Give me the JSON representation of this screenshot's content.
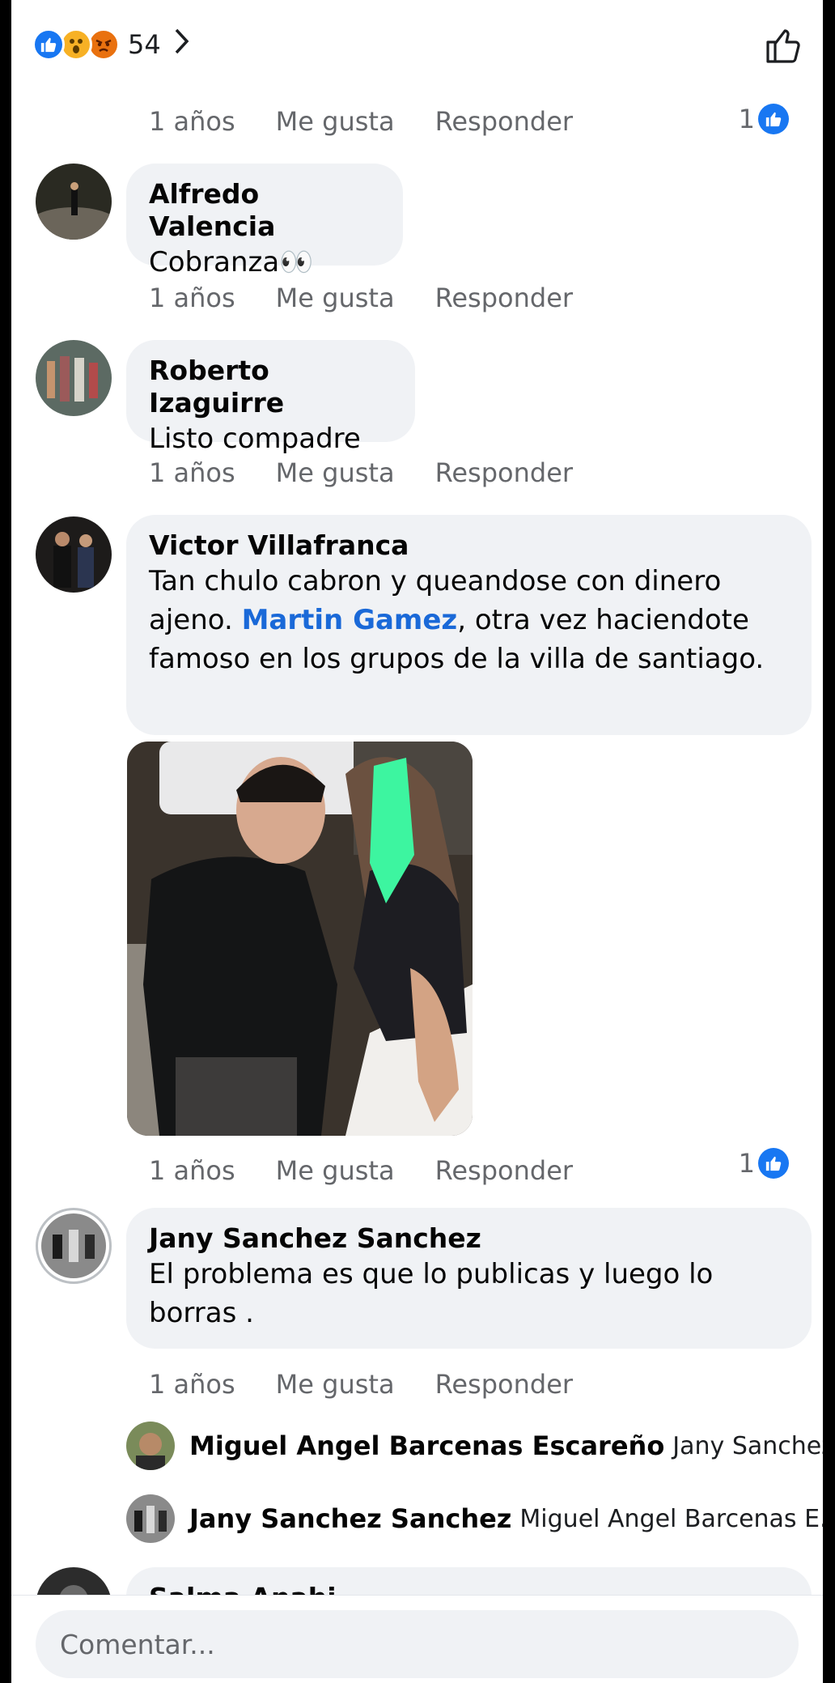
{
  "reactions": {
    "count": "54",
    "types": [
      "like",
      "wow",
      "angry"
    ]
  },
  "actions": {
    "time": "1 años",
    "like": "Me gusta",
    "reply": "Responder"
  },
  "comments": [
    {
      "name": "Alfredo Valencia",
      "text": "Cobranza👀"
    },
    {
      "name": "Roberto Izaguirre",
      "text": "Listo compadre"
    },
    {
      "name": "Victor Villafranca",
      "text_before": "Tan chulo cabron y queandose con dinero ajeno. ",
      "mention": "Martin Gamez",
      "text_after": ", otra vez haciendote famoso en los grupos de la villa de santiago."
    },
    {
      "name": "Jany Sanchez Sanchez",
      "text": "El problema es que lo publicas y luego lo borras ."
    },
    {
      "name": "Salma Anahi"
    }
  ],
  "comment_likes": [
    "1",
    "1"
  ],
  "replies": [
    {
      "name": "Miguel Angel Barcenas Escareño",
      "text": "Jany Sanchez..."
    },
    {
      "name": "Jany Sanchez Sanchez",
      "text": "Miguel Angel Barcenas E..."
    }
  ],
  "composer": {
    "placeholder": "Comentar..."
  },
  "colors": {
    "accent": "#1877f2",
    "bubble": "#f0f2f5",
    "muted": "#65676b",
    "mention": "#1a69d8"
  }
}
